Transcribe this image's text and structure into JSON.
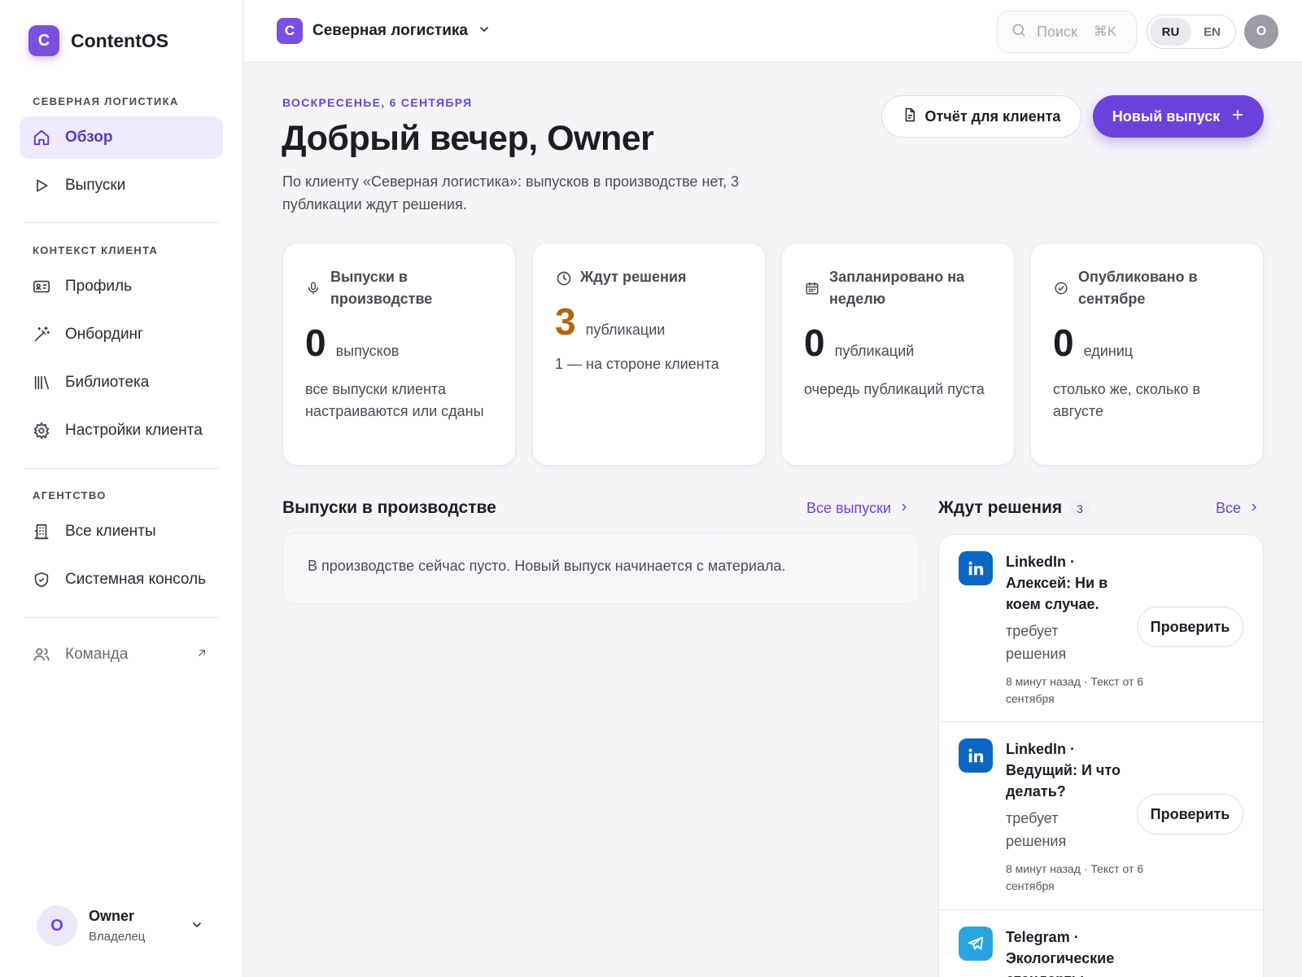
{
  "app": {
    "logo_letter": "C",
    "name": "ContentOS"
  },
  "sidebar": {
    "section_client": "СЕВЕРНАЯ ЛОГИСТИКА",
    "overview": "Обзор",
    "releases": "Выпуски",
    "section_context": "КОНТЕКСТ КЛИЕНТА",
    "profile": "Профиль",
    "onboarding": "Онбординг",
    "library": "Библиотека",
    "client_settings": "Настройки клиента",
    "section_agency": "АГЕНТСТВО",
    "all_clients": "Все клиенты",
    "system_console": "Системная консоль",
    "team": "Команда",
    "user": {
      "avatar_letter": "O",
      "name": "Owner",
      "role": "Владелец"
    }
  },
  "topbar": {
    "client_logo_letter": "C",
    "client_name": "Северная логистика",
    "search_placeholder": "Поиск",
    "search_shortcut": "⌘K",
    "lang_ru": "RU",
    "lang_en": "EN",
    "lang_active": "RU",
    "avatar_letter": "O"
  },
  "header": {
    "eyebrow": "ВОСКРЕСЕНЬЕ, 6 СЕНТЯБРЯ",
    "greeting": "Добрый вечер, Owner",
    "subtitle": "По клиенту «Северная логистика»: выпусков в производстве нет, 3 публикации ждут решения.",
    "report_button": "Отчёт для клиента",
    "new_release_button": "Новый выпуск"
  },
  "stats": [
    {
      "icon": "microphone-icon",
      "title": "Выпуски в производстве",
      "value": "0",
      "unit": "выпусков",
      "note": "все выпуски клиента настраиваются или сданы"
    },
    {
      "icon": "clock-icon",
      "title": "Ждут решения",
      "value": "3",
      "unit": "публикации",
      "note": "1 — на стороне клиента",
      "accent": "#b5650d"
    },
    {
      "icon": "calendar-icon",
      "title": "Запланировано на неделю",
      "value": "0",
      "unit": "публикаций",
      "note": "очередь публикаций пуста"
    },
    {
      "icon": "check-circle-icon",
      "title": "Опубликовано в сентябре",
      "value": "0",
      "unit": "единиц",
      "note": "столько же, сколько в августе"
    }
  ],
  "production": {
    "title": "Выпуски в производстве",
    "link": "Все выпуски",
    "empty_text": "В производстве сейчас пусто. Новый выпуск начинается с материала."
  },
  "pending": {
    "title": "Ждут решения",
    "count": "3",
    "link": "Все",
    "items": [
      {
        "platform": "linkedin-icon",
        "title": "LinkedIn · Алексей: Ни в коем случае.",
        "status": "требует решения",
        "meta": "8 минут назад · Текст от 6 сентября",
        "action": "Проверить"
      },
      {
        "platform": "linkedin-icon",
        "title": "LinkedIn · Ведущий: И что делать?",
        "status": "требует решения",
        "meta": "8 минут назад · Текст от 6 сентября",
        "action": "Проверить"
      },
      {
        "platform": "telegram-icon",
        "title": "Telegram · Экологические стандарты",
        "status": "",
        "meta": "",
        "action": ""
      }
    ]
  },
  "colors": {
    "accent": "#6c42dc",
    "accent_soft": "#efeafd",
    "warning": "#b5650d",
    "linkedin": "#0a66c2",
    "telegram": "#2aa4e0"
  }
}
